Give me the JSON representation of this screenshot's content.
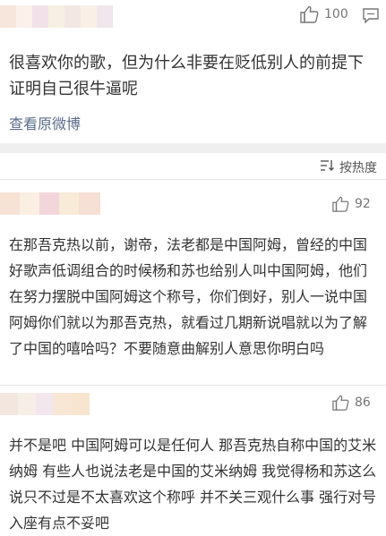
{
  "first_post": {
    "like_count": "100",
    "text": "很喜欢你的歌，但为什么非要在贬低别人的前提下证明自己很牛逼呢",
    "view_original": "查看原微博"
  },
  "sort": {
    "label": "按热度"
  },
  "comments": [
    {
      "like_count": "92",
      "text": "在那吾克热以前，谢帝，法老都是中国阿姆，曾经的中国好歌声低调组合的时候杨和苏也给别人叫中国阿姆，他们在努力摆脱中国阿姆这个称号，你们倒好，别人一说中国阿姆你们就以为那吾克热，就看过几期新说唱就以为了解了中国的嘻哈吗？不要随意曲解别人意思你明白吗"
    },
    {
      "like_count": "86",
      "text": "并不是吧 中国阿姆可以是任何人 那吾克热自称中国的艾米纳姆 有些人也说法老是中国的艾米纳姆 我觉得杨和苏这么说只不过是不太喜欢这个称呼 并不关三观什么事 强行对号入座有点不妥吧"
    }
  ],
  "colors": {
    "link": "#5b6c8a",
    "divider": "#e6e6e6",
    "background_gap": "#efefef"
  }
}
